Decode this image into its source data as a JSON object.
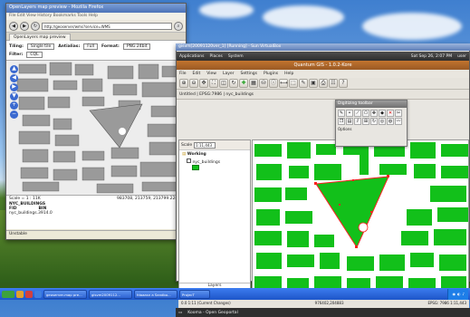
{
  "firefox": {
    "title": "OpenLayers map preview - Mozilla Firefox",
    "menu": "File  Edit  View  History  Bookmarks  Tools  Help",
    "url": "http://geoserver/wms?service=WMS",
    "tab": "OpenLayers map preview",
    "opt_tiling_label": "Tiling:",
    "opt_tiling_value": "Single tile",
    "opt_antialias_label": "Antialias:",
    "opt_antialias_value": "Full",
    "opt_format_label": "Format:",
    "opt_format_value": "PNG 24bit",
    "opt_filter_label": "Filter:",
    "opt_filter_value": "CQL",
    "scale": "Scale = 1 : 11K",
    "coords": "983708, 213759, 213799.22831",
    "layer_name": "NYC_BUILDINGS",
    "fid_label": "FID",
    "bin_label": "BIN",
    "row": "nyc_buildings.3914.0",
    "status": "Unstable"
  },
  "vbox": {
    "title": "gisvm[20091120ver_1] [Running] - Sun VirtualBox"
  },
  "gnome": {
    "applications": "Applications",
    "places": "Places",
    "system": "System",
    "clock": "Sat Sep 26, 2:07 PM",
    "user": "user"
  },
  "qgis": {
    "title": "Quantum GIS - 1.0.2-Kore",
    "menu": [
      "File",
      "Edit",
      "View",
      "Layer",
      "Settings",
      "Plugins",
      "Help"
    ],
    "toolbar2_text": "Untitled | EPSG:7986 | nyc_buildings",
    "scale_label": "Scale",
    "scale_value": "1:11,443",
    "layer_group": "Working",
    "layer_item": "nyc_buildings",
    "layers_tab": "Layers",
    "bookmark": "Bookmark manager",
    "status_left": "0.0 1:11 (Current Changes)",
    "status_right": "EPSG: 7986  1:11,443",
    "status_coords": "976402,204883",
    "bottom_task": "Kooma - Open Geoportal"
  },
  "digitize": {
    "title": "Digitizing toolbar",
    "options": "Options"
  },
  "taskbar": {
    "items": [
      "geoserver-map pre...",
      "gisvm2009112...",
      "fdaaasn a Sandbo...",
      "ProjecT"
    ]
  },
  "colors": {
    "qgis_fill": "#12c01a",
    "ff_fill": "#9a9a9a",
    "selection": "#ff2020"
  }
}
